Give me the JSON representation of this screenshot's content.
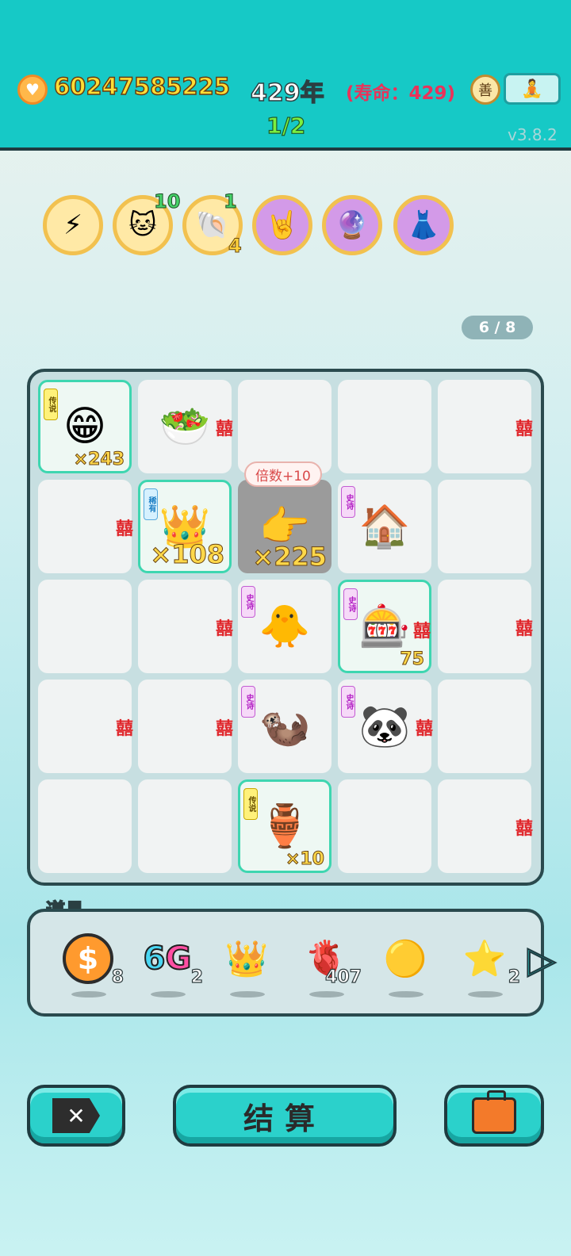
{
  "header": {
    "coins": "60247585225",
    "year": "429年",
    "lifespan": "(寿命：429)",
    "round": "1/2",
    "version": "v3.8.2"
  },
  "buffs": [
    {
      "icon": "lightning-icon",
      "glyph": "⚡"
    },
    {
      "icon": "cat-icon",
      "glyph": "🐱",
      "top_count": "10"
    },
    {
      "icon": "shell-icon",
      "glyph": "🐚",
      "top_count": "1",
      "bottom_count": "4"
    },
    {
      "icon": "rock-hand-icon",
      "glyph": "🤘"
    },
    {
      "icon": "yinyang-orb-icon",
      "glyph": "🔮"
    },
    {
      "icon": "skirt-icon",
      "glyph": "👗"
    }
  ],
  "page_indicator": "6 / 8",
  "board": {
    "tooltip": "倍数+10",
    "rarity_labels": {
      "legend": "传说",
      "epic": "史诗",
      "rare": "稀有"
    },
    "cells": [
      {
        "glyph": "😁",
        "tag": "legend",
        "mult": "×243",
        "hl": true
      },
      {
        "glyph": "🥗",
        "mark": "囍"
      },
      {},
      {},
      {
        "mark": "囍"
      },
      {
        "mark": "囍"
      },
      {
        "glyph": "👑",
        "tag": "rare",
        "mult": "×108",
        "hl": true,
        "big": true
      },
      {
        "glyph": "👉",
        "mult": "×225",
        "dark": true,
        "big": true
      },
      {
        "glyph": "🏠",
        "tag": "epic"
      },
      {},
      {},
      {
        "mark": "囍"
      },
      {
        "glyph": "🐥",
        "tag": "epic"
      },
      {
        "glyph": "🎰",
        "tag": "epic",
        "mark": "囍",
        "mult": "75",
        "hl": true
      },
      {
        "mark": "囍"
      },
      {
        "mark": "囍"
      },
      {
        "mark": "囍"
      },
      {
        "glyph": "🦦",
        "tag": "epic"
      },
      {
        "glyph": "🐼",
        "tag": "epic",
        "mark": "囍"
      },
      {},
      {},
      {},
      {
        "glyph": "🏺",
        "tag": "legend",
        "mult": "×10",
        "hl": true
      },
      {},
      {
        "mark": "囍"
      }
    ]
  },
  "props": {
    "label": "道具",
    "items": [
      {
        "icon": "dollar-coin-icon",
        "count": "8"
      },
      {
        "icon": "6g-icon",
        "text_a": "6",
        "text_b": "G",
        "count": "2"
      },
      {
        "icon": "crown-icon",
        "glyph": "👑",
        "count": ""
      },
      {
        "icon": "liver-icon",
        "glyph": "🫀",
        "count": "407"
      },
      {
        "icon": "gold-ball-icon",
        "glyph": "🟡",
        "count": ""
      },
      {
        "icon": "star-icon",
        "glyph": "⭐",
        "count": "2"
      }
    ]
  },
  "buttons": {
    "settle": "结算",
    "close_glyph": "✕"
  }
}
